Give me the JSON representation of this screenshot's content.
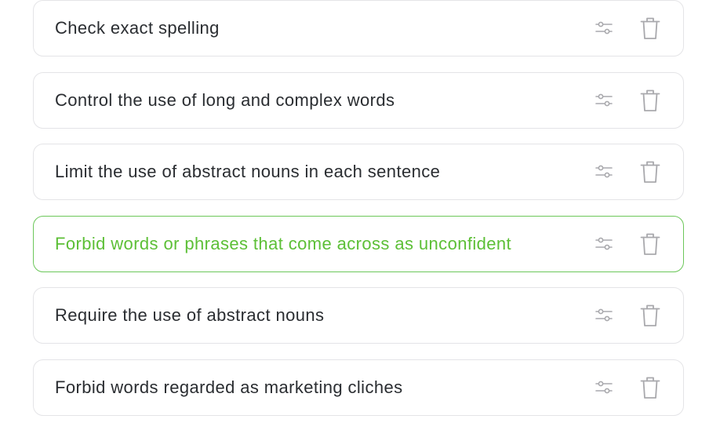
{
  "rules": [
    {
      "label": "Check exact spelling",
      "active": false
    },
    {
      "label": "Control the use of long and complex words",
      "active": false
    },
    {
      "label": "Limit the use of abstract nouns in each sentence",
      "active": false
    },
    {
      "label": "Forbid words or phrases that come across as unconfident",
      "active": true
    },
    {
      "label": "Require the use of abstract nouns",
      "active": false
    },
    {
      "label": "Forbid words regarded as marketing cliches",
      "active": false
    }
  ],
  "icons": {
    "settings": "sliders-icon",
    "delete": "trash-icon"
  },
  "colors": {
    "active_accent": "#5cbf36",
    "border": "#e4e4e7",
    "text": "#2a2d31",
    "icon": "#a9a9ad"
  }
}
